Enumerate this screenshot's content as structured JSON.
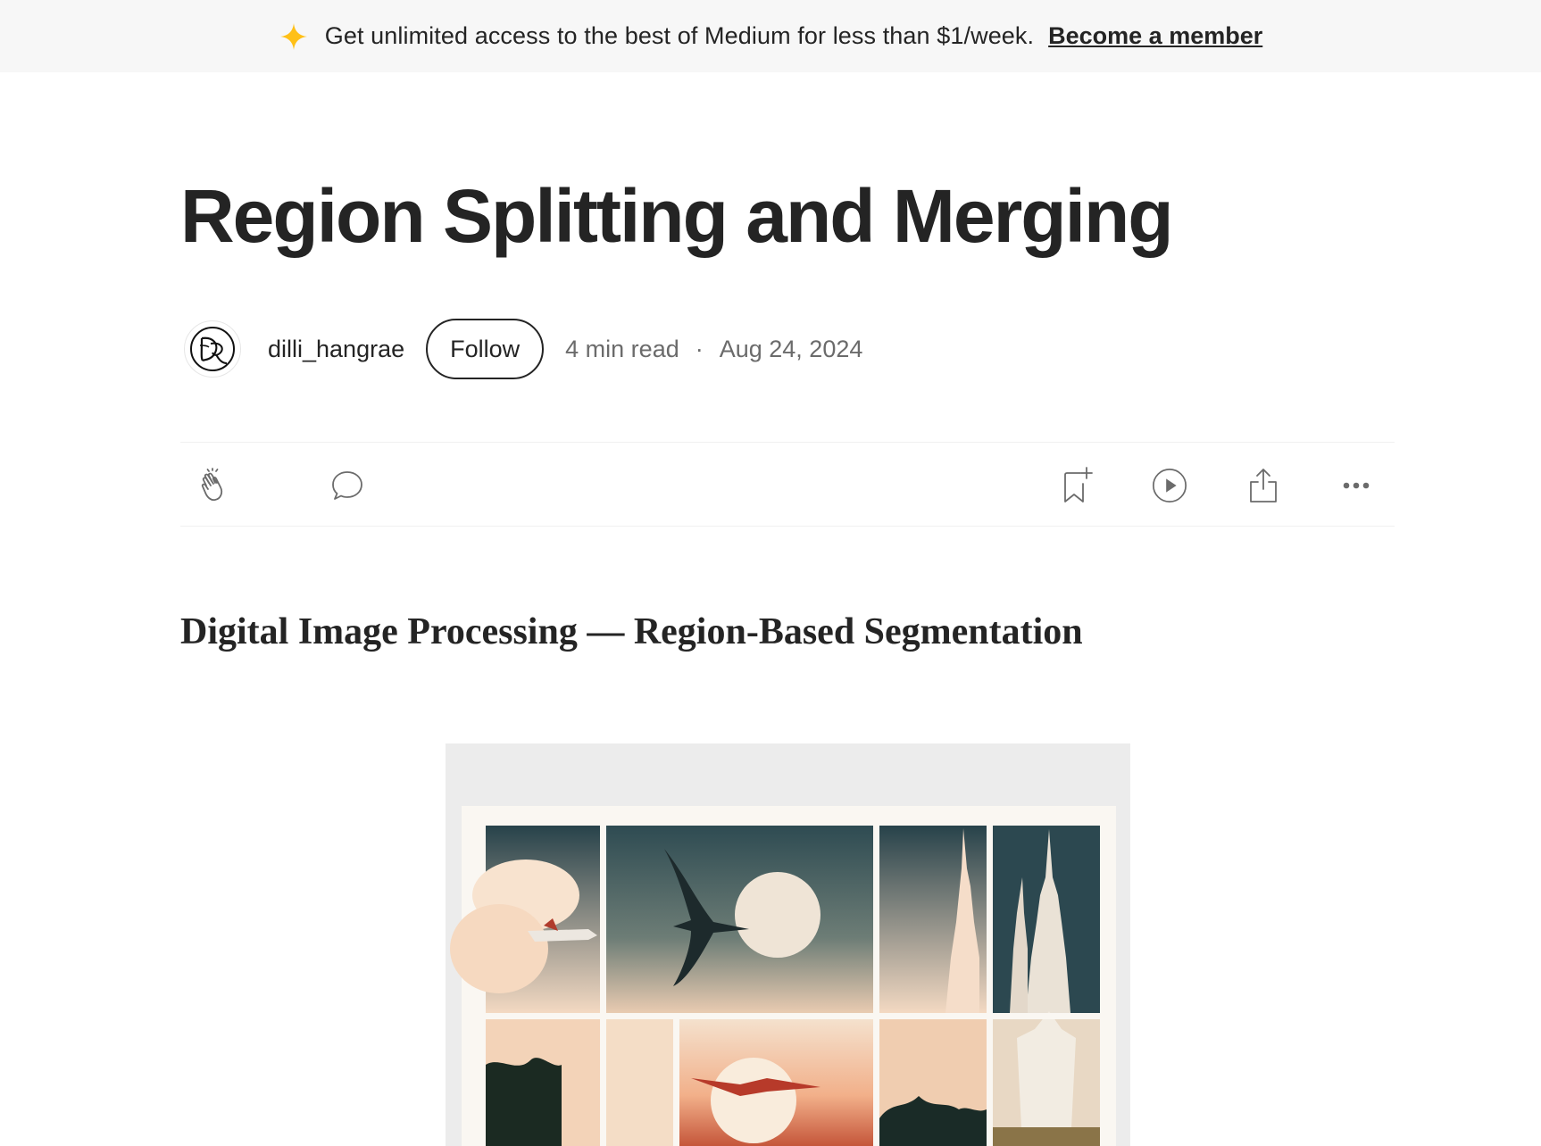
{
  "banner": {
    "icon": "sparkle-icon",
    "text": "Get unlimited access to the best of Medium for less than $1/week.",
    "link": "Become a member",
    "accent": "#ffc017"
  },
  "article": {
    "title": "Region Splitting and Merging",
    "subtitle": "Digital Image Processing — Region-Based Segmentation"
  },
  "author": {
    "name": "dilli_hangrae",
    "follow_label": "Follow",
    "read_time": "4 min read",
    "separator": "·",
    "date": "Aug 24, 2024"
  },
  "actions": {
    "left": [
      "clap-icon",
      "comment-icon"
    ],
    "right": [
      "bookmark-add-icon",
      "play-icon",
      "share-icon",
      "more-icon"
    ]
  },
  "hero_image": {
    "description_icon": "illustration-image"
  }
}
